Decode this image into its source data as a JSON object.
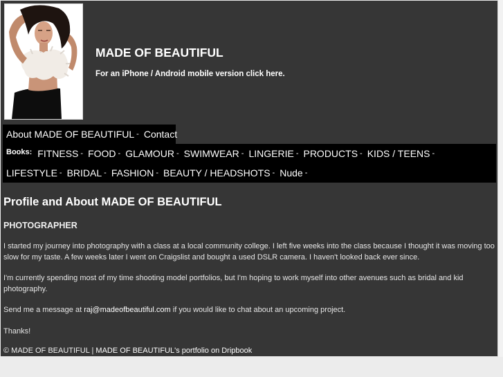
{
  "header": {
    "site_title": "MADE OF BEAUTIFUL",
    "mobile_link": "For an iPhone / Android mobile version click here."
  },
  "nav": {
    "items": [
      {
        "label": "About MADE OF BEAUTIFUL",
        "sep": "-"
      },
      {
        "label": "Contact",
        "sep": ""
      }
    ]
  },
  "books": {
    "label": "Books:",
    "row1": [
      {
        "label": "FITNESS",
        "sep": "-"
      },
      {
        "label": "FOOD",
        "sep": "-"
      },
      {
        "label": "GLAMOUR",
        "sep": "-"
      },
      {
        "label": "SWIMWEAR",
        "sep": "-"
      },
      {
        "label": "LINGERIE",
        "sep": "-"
      },
      {
        "label": "PRODUCTS",
        "sep": "-"
      },
      {
        "label": "KIDS / TEENS",
        "sep": "-"
      }
    ],
    "row2": [
      {
        "label": "LIFESTYLE",
        "sep": "-"
      },
      {
        "label": "BRIDAL",
        "sep": "-"
      },
      {
        "label": "FASHION",
        "sep": "-"
      },
      {
        "label": "BEAUTY / HEADSHOTS",
        "sep": "-"
      },
      {
        "label": "Nude",
        "sep": "-"
      }
    ]
  },
  "profile": {
    "heading": "Profile and About MADE OF BEAUTIFUL",
    "role": "PHOTOGRAPHER",
    "para1": "I started my journey into photography with a class at a local community college. I left five weeks into the class because I thought it was moving too slow for my taste. A few weeks later I went on Craigslist and bought a used DSLR camera. I haven't looked back ever since.",
    "para2": "I'm currently spending most of my time shooting model portfolios, but I'm hoping to work myself into other avenues such as bridal and kid photography.",
    "para3_before": "Send me a message at ",
    "email": "raj@madeofbeautiful.com",
    "para3_after": " if you would like to chat about an upcoming project.",
    "para4": "Thanks!"
  },
  "footer": {
    "copyright": "© MADE OF BEAUTIFUL",
    "divider": " | ",
    "portfolio_link": "MADE OF BEAUTIFUL's portfolio on Dripbook"
  },
  "colors": {
    "page_bg": "#363636",
    "nav_bg": "#000000",
    "outer_bg": "#ececec"
  }
}
